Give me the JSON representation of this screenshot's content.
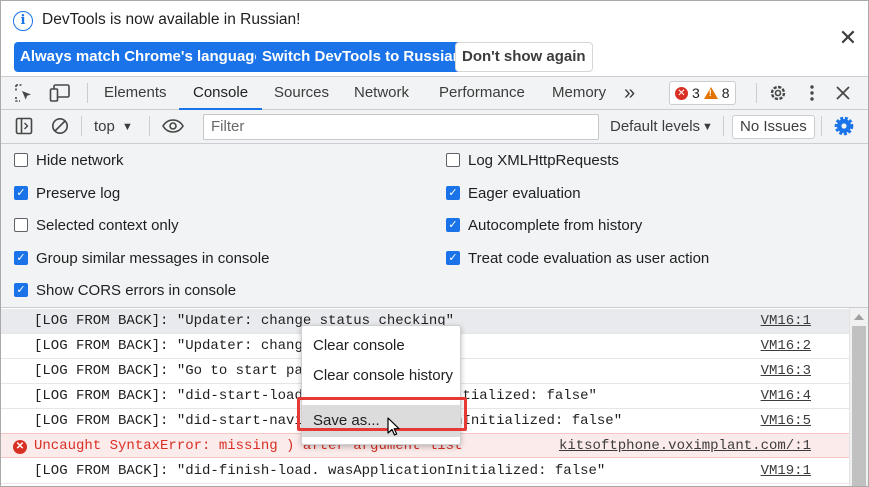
{
  "infobar": {
    "message": "DevTools is now available in Russian!",
    "buttons": {
      "always_match": "Always match Chrome's language",
      "switch_russian": "Switch DevTools to Russian",
      "dont_show": "Don't show again"
    },
    "close_icon": "✕",
    "info_icon": "i"
  },
  "tabs": {
    "items": [
      "Elements",
      "Console",
      "Sources",
      "Network",
      "Performance",
      "Memory"
    ],
    "active": "Console",
    "more": "»",
    "errors": "3",
    "warnings": "8"
  },
  "console_toolbar": {
    "context": "top",
    "filter_placeholder": "Filter",
    "levels": "Default levels",
    "issues": "No Issues"
  },
  "settings": {
    "left": [
      {
        "label": "Hide network",
        "checked": false
      },
      {
        "label": "Preserve log",
        "checked": true
      },
      {
        "label": "Selected context only",
        "checked": false
      },
      {
        "label": "Group similar messages in console",
        "checked": true
      },
      {
        "label": "Show CORS errors in console",
        "checked": true
      }
    ],
    "right": [
      {
        "label": "Log XMLHttpRequests",
        "checked": false
      },
      {
        "label": "Eager evaluation",
        "checked": true
      },
      {
        "label": "Autocomplete from history",
        "checked": true
      },
      {
        "label": "Treat code evaluation as user action",
        "checked": true
      }
    ]
  },
  "log": [
    {
      "text": "[LOG FROM BACK]: \"Updater: change status checking\"",
      "source": "VM16:1",
      "kind": "highlight"
    },
    {
      "text": "[LOG FROM BACK]: \"Updater: change",
      "source": "VM16:2",
      "kind": "log"
    },
    {
      "text": "[LOG FROM BACK]: \"Go to start pag",
      "source": "VM16:3",
      "kind": "log"
    },
    {
      "text": "[LOG FROM BACK]: \"did-start-load                 nitialized: false\"",
      "source": "VM16:4",
      "kind": "log"
    },
    {
      "text": "[LOG FROM BACK]: \"did-start-navig                onInitialized: false\"",
      "source": "VM16:5",
      "kind": "log"
    },
    {
      "text": "Uncaught SyntaxError: missing ) after argument list",
      "source": "kitsoftphone.voximplant.com/:1",
      "kind": "error"
    },
    {
      "text": "[LOG FROM BACK]: \"did-finish-load. wasApplicationInitialized: false\"",
      "source": "VM19:1",
      "kind": "log"
    }
  ],
  "context_menu": {
    "clear_console": "Clear console",
    "clear_history": "Clear console history",
    "save_as": "Save as..."
  },
  "colors": {
    "accent": "#1a73e8",
    "error": "#d93025",
    "warning": "#e37400",
    "highlight_box": "#e53935"
  }
}
